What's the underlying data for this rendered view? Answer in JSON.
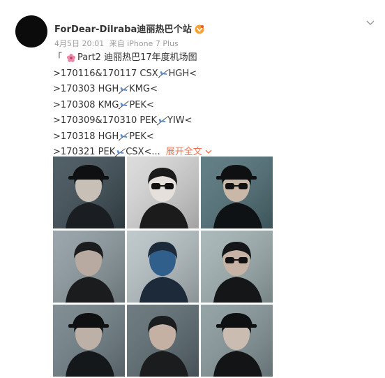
{
  "post": {
    "username": "ForDear-Dilraba迪丽热巴个站",
    "timestamp": "4月5日 20:01",
    "source": "来自 iPhone 7 Plus",
    "title_open": "「",
    "title_text": "Part2 迪丽热巴17年度机场图",
    "lines": [
      {
        "date": ">170116&170117 CSX",
        "dest": "HGH<"
      },
      {
        "date": ">170303 HGH",
        "dest": "KMG<"
      },
      {
        "date": ">170308 KMG",
        "dest": "PEK<"
      },
      {
        "date": ">170309&170310 PEK",
        "dest": "YIW<"
      },
      {
        "date": ">170318 HGH",
        "dest": "PEK<"
      },
      {
        "date": ">170321 PEK",
        "dest": "CSX<..."
      }
    ],
    "expand_label": "展开全文",
    "icons": {
      "vip": "vip-badge-icon",
      "title_emoji": "flower-icon",
      "route_separator": "airplane-icon",
      "menu": "chevron-down-icon"
    },
    "colors": {
      "accent": "#eb7350",
      "meta": "#9a9a9a",
      "text": "#333333"
    }
  },
  "photos": [
    {
      "name": "photo-1"
    },
    {
      "name": "photo-2"
    },
    {
      "name": "photo-3"
    },
    {
      "name": "photo-4"
    },
    {
      "name": "photo-5"
    },
    {
      "name": "photo-6"
    },
    {
      "name": "photo-7"
    },
    {
      "name": "photo-8"
    },
    {
      "name": "photo-9"
    }
  ]
}
